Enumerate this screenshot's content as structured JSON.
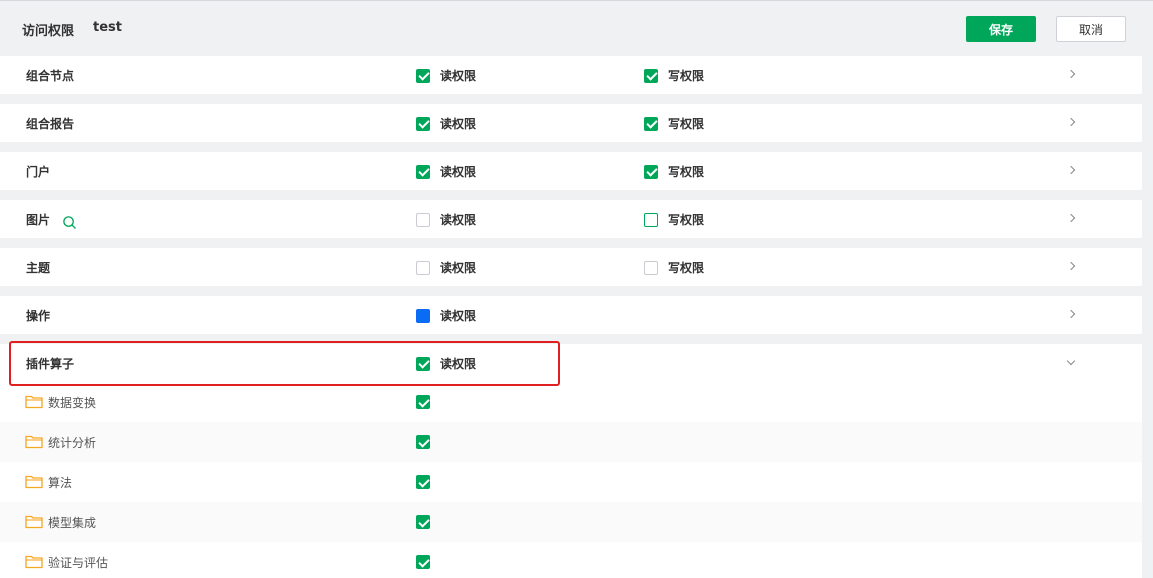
{
  "header": {
    "title": "访问权限",
    "user": "test",
    "save_label": "保存",
    "cancel_label": "取消"
  },
  "colors": {
    "accent": "#00a65a",
    "partial": "#0a6cf5",
    "highlight": "#e02020"
  },
  "categories": [
    {
      "label": "组合节点",
      "read": "读权限",
      "read_state": "checked",
      "write": "写权限",
      "write_state": "checked",
      "expander": "chevron-right-icon"
    },
    {
      "label": "组合报告",
      "read": "读权限",
      "read_state": "checked",
      "write": "写权限",
      "write_state": "checked",
      "expander": "chevron-right-icon"
    },
    {
      "label": "门户",
      "read": "读权限",
      "read_state": "checked",
      "write": "写权限",
      "write_state": "checked",
      "expander": "chevron-right-icon"
    },
    {
      "label": "图片",
      "read": "读权限",
      "read_state": "unchecked",
      "write": "写权限",
      "write_state": "unchecked",
      "expander": "chevron-right-icon",
      "extra_icon": "search-icon"
    },
    {
      "label": "主题",
      "read": "读权限",
      "read_state": "unchecked",
      "write": "写权限",
      "write_state": "unchecked",
      "expander": "chevron-right-icon"
    },
    {
      "label": "操作",
      "read": "读权限",
      "read_state": "partial",
      "expander": "chevron-right-icon"
    },
    {
      "label": "插件算子",
      "read": "读权限",
      "read_state": "checked",
      "expander": "chevron-down-icon"
    }
  ],
  "plugin_children": [
    {
      "label": "数据变换",
      "icon": "folder-icon",
      "state": "checked"
    },
    {
      "label": "统计分析",
      "icon": "folder-icon",
      "state": "checked"
    },
    {
      "label": "算法",
      "icon": "folder-icon",
      "state": "checked"
    },
    {
      "label": "模型集成",
      "icon": "folder-icon",
      "state": "checked"
    },
    {
      "label": "验证与评估",
      "icon": "folder-icon",
      "state": "checked"
    }
  ]
}
